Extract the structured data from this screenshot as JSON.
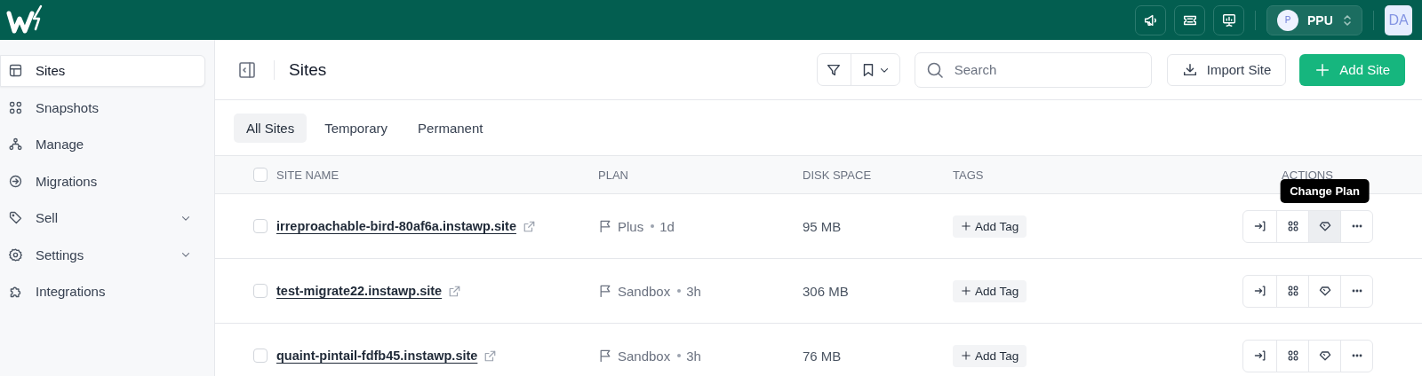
{
  "topbar": {
    "icon_buttons": [
      {
        "kind": "megaphone"
      },
      {
        "kind": "ticket"
      },
      {
        "kind": "presentation"
      }
    ],
    "workspace": {
      "avatar": "P",
      "name": "PPU"
    },
    "user": {
      "initials": "DA"
    }
  },
  "sidebar": {
    "items": [
      {
        "label": "Sites",
        "selected": true,
        "has_submenu": false
      },
      {
        "label": "Snapshots",
        "selected": false,
        "has_submenu": false
      },
      {
        "label": "Manage",
        "selected": false,
        "has_submenu": false
      },
      {
        "label": "Migrations",
        "selected": false,
        "has_submenu": false
      },
      {
        "label": "Sell",
        "selected": false,
        "has_submenu": true
      },
      {
        "label": "Settings",
        "selected": false,
        "has_submenu": true
      },
      {
        "label": "Integrations",
        "selected": false,
        "has_submenu": false
      }
    ]
  },
  "header": {
    "title": "Sites",
    "search": {
      "placeholder": "Search"
    },
    "buttons": [
      {
        "label": "Import Site",
        "kind": "secondary"
      },
      {
        "label": "Add Site",
        "kind": "primary"
      }
    ]
  },
  "tabs": [
    {
      "label": "All Sites",
      "selected": true
    },
    {
      "label": "Temporary",
      "selected": false
    },
    {
      "label": "Permanent",
      "selected": false
    }
  ],
  "table": {
    "select_all": {
      "checked": false
    },
    "columns": [
      "SITE NAME",
      "PLAN",
      "DISK SPACE",
      "TAGS",
      "ACTIONS"
    ],
    "rows": [
      {
        "checked": false,
        "site": "irreproachable-bird-80af6a.instawp.site",
        "plan": {
          "name": "Plus",
          "age": "1d"
        },
        "disk": "95 MB",
        "tag_button": "Add Tag",
        "actions": [
          {
            "kind": "login",
            "hovered": false
          },
          {
            "kind": "apps",
            "hovered": false
          },
          {
            "kind": "plan",
            "hovered": true,
            "tooltip": "Change Plan"
          },
          {
            "kind": "more",
            "hovered": false
          }
        ]
      },
      {
        "checked": false,
        "site": "test-migrate22.instawp.site",
        "plan": {
          "name": "Sandbox",
          "age": "3h"
        },
        "disk": "306 MB",
        "tag_button": "Add Tag",
        "actions": [
          {
            "kind": "login",
            "hovered": false
          },
          {
            "kind": "apps",
            "hovered": false
          },
          {
            "kind": "plan",
            "hovered": false
          },
          {
            "kind": "more",
            "hovered": false
          }
        ]
      },
      {
        "checked": false,
        "site": "quaint-pintail-fdfb45.instawp.site",
        "plan": {
          "name": "Sandbox",
          "age": "3h"
        },
        "disk": "76 MB",
        "tag_button": "Add Tag",
        "actions": [
          {
            "kind": "login",
            "hovered": false
          },
          {
            "kind": "apps",
            "hovered": false
          },
          {
            "kind": "plan",
            "hovered": false
          },
          {
            "kind": "more",
            "hovered": false
          }
        ]
      }
    ]
  }
}
